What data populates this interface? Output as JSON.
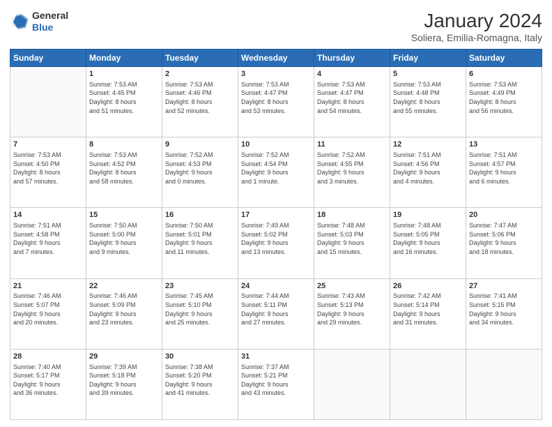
{
  "logo": {
    "line1": "General",
    "line2": "Blue"
  },
  "title": "January 2024",
  "subtitle": "Soliera, Emilia-Romagna, Italy",
  "weekdays": [
    "Sunday",
    "Monday",
    "Tuesday",
    "Wednesday",
    "Thursday",
    "Friday",
    "Saturday"
  ],
  "weeks": [
    [
      {
        "day": "",
        "info": ""
      },
      {
        "day": "1",
        "info": "Sunrise: 7:53 AM\nSunset: 4:45 PM\nDaylight: 8 hours\nand 51 minutes."
      },
      {
        "day": "2",
        "info": "Sunrise: 7:53 AM\nSunset: 4:46 PM\nDaylight: 8 hours\nand 52 minutes."
      },
      {
        "day": "3",
        "info": "Sunrise: 7:53 AM\nSunset: 4:47 PM\nDaylight: 8 hours\nand 53 minutes."
      },
      {
        "day": "4",
        "info": "Sunrise: 7:53 AM\nSunset: 4:47 PM\nDaylight: 8 hours\nand 54 minutes."
      },
      {
        "day": "5",
        "info": "Sunrise: 7:53 AM\nSunset: 4:48 PM\nDaylight: 8 hours\nand 55 minutes."
      },
      {
        "day": "6",
        "info": "Sunrise: 7:53 AM\nSunset: 4:49 PM\nDaylight: 8 hours\nand 56 minutes."
      }
    ],
    [
      {
        "day": "7",
        "info": "Sunrise: 7:53 AM\nSunset: 4:50 PM\nDaylight: 8 hours\nand 57 minutes."
      },
      {
        "day": "8",
        "info": "Sunrise: 7:53 AM\nSunset: 4:52 PM\nDaylight: 8 hours\nand 58 minutes."
      },
      {
        "day": "9",
        "info": "Sunrise: 7:52 AM\nSunset: 4:53 PM\nDaylight: 9 hours\nand 0 minutes."
      },
      {
        "day": "10",
        "info": "Sunrise: 7:52 AM\nSunset: 4:54 PM\nDaylight: 9 hours\nand 1 minute."
      },
      {
        "day": "11",
        "info": "Sunrise: 7:52 AM\nSunset: 4:55 PM\nDaylight: 9 hours\nand 3 minutes."
      },
      {
        "day": "12",
        "info": "Sunrise: 7:51 AM\nSunset: 4:56 PM\nDaylight: 9 hours\nand 4 minutes."
      },
      {
        "day": "13",
        "info": "Sunrise: 7:51 AM\nSunset: 4:57 PM\nDaylight: 9 hours\nand 6 minutes."
      }
    ],
    [
      {
        "day": "14",
        "info": "Sunrise: 7:51 AM\nSunset: 4:58 PM\nDaylight: 9 hours\nand 7 minutes."
      },
      {
        "day": "15",
        "info": "Sunrise: 7:50 AM\nSunset: 5:00 PM\nDaylight: 9 hours\nand 9 minutes."
      },
      {
        "day": "16",
        "info": "Sunrise: 7:50 AM\nSunset: 5:01 PM\nDaylight: 9 hours\nand 11 minutes."
      },
      {
        "day": "17",
        "info": "Sunrise: 7:49 AM\nSunset: 5:02 PM\nDaylight: 9 hours\nand 13 minutes."
      },
      {
        "day": "18",
        "info": "Sunrise: 7:48 AM\nSunset: 5:03 PM\nDaylight: 9 hours\nand 15 minutes."
      },
      {
        "day": "19",
        "info": "Sunrise: 7:48 AM\nSunset: 5:05 PM\nDaylight: 9 hours\nand 16 minutes."
      },
      {
        "day": "20",
        "info": "Sunrise: 7:47 AM\nSunset: 5:06 PM\nDaylight: 9 hours\nand 18 minutes."
      }
    ],
    [
      {
        "day": "21",
        "info": "Sunrise: 7:46 AM\nSunset: 5:07 PM\nDaylight: 9 hours\nand 20 minutes."
      },
      {
        "day": "22",
        "info": "Sunrise: 7:46 AM\nSunset: 5:09 PM\nDaylight: 9 hours\nand 23 minutes."
      },
      {
        "day": "23",
        "info": "Sunrise: 7:45 AM\nSunset: 5:10 PM\nDaylight: 9 hours\nand 25 minutes."
      },
      {
        "day": "24",
        "info": "Sunrise: 7:44 AM\nSunset: 5:11 PM\nDaylight: 9 hours\nand 27 minutes."
      },
      {
        "day": "25",
        "info": "Sunrise: 7:43 AM\nSunset: 5:13 PM\nDaylight: 9 hours\nand 29 minutes."
      },
      {
        "day": "26",
        "info": "Sunrise: 7:42 AM\nSunset: 5:14 PM\nDaylight: 9 hours\nand 31 minutes."
      },
      {
        "day": "27",
        "info": "Sunrise: 7:41 AM\nSunset: 5:15 PM\nDaylight: 9 hours\nand 34 minutes."
      }
    ],
    [
      {
        "day": "28",
        "info": "Sunrise: 7:40 AM\nSunset: 5:17 PM\nDaylight: 9 hours\nand 36 minutes."
      },
      {
        "day": "29",
        "info": "Sunrise: 7:39 AM\nSunset: 5:18 PM\nDaylight: 9 hours\nand 39 minutes."
      },
      {
        "day": "30",
        "info": "Sunrise: 7:38 AM\nSunset: 5:20 PM\nDaylight: 9 hours\nand 41 minutes."
      },
      {
        "day": "31",
        "info": "Sunrise: 7:37 AM\nSunset: 5:21 PM\nDaylight: 9 hours\nand 43 minutes."
      },
      {
        "day": "",
        "info": ""
      },
      {
        "day": "",
        "info": ""
      },
      {
        "day": "",
        "info": ""
      }
    ]
  ]
}
